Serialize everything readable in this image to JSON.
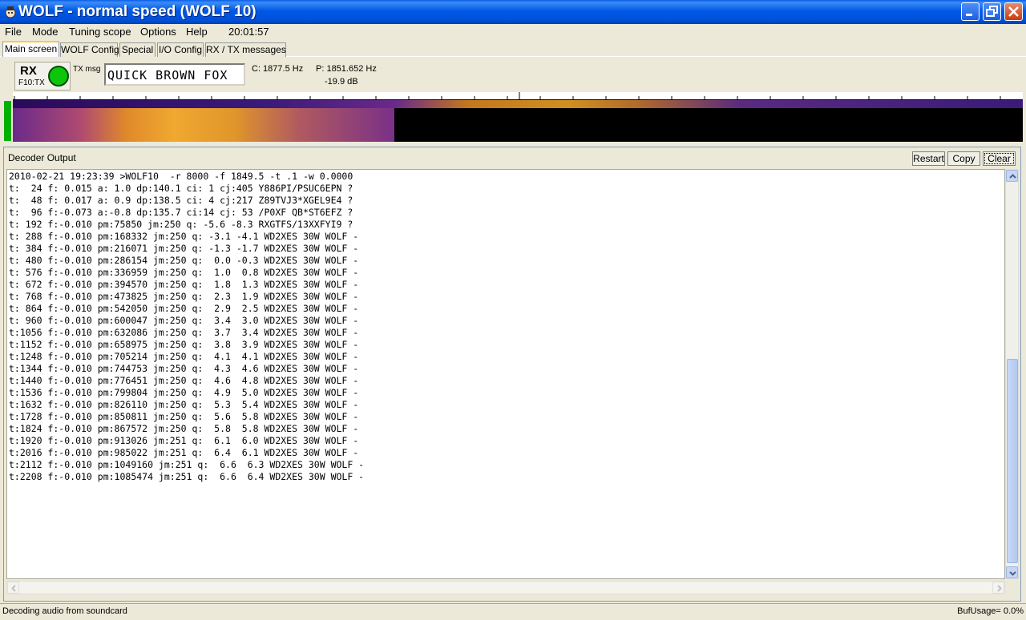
{
  "window": {
    "title": "WOLF - normal speed (WOLF 10)"
  },
  "menu": {
    "items": [
      "File",
      "Mode",
      "Tuning scope",
      "Options",
      "Help"
    ],
    "clock": "20:01:57"
  },
  "tabs": [
    {
      "label": "Main screen",
      "active": true
    },
    {
      "label": "WOLF Config"
    },
    {
      "label": "Special"
    },
    {
      "label": "I/O Config"
    },
    {
      "label": "RX / TX messages"
    }
  ],
  "rx_panel": {
    "mode": "RX",
    "hint": "F10:TX",
    "txmsg_label": "TX msg",
    "txmsg_value": "QUICK BROWN FOX",
    "c_freq": "C: 1877.5 Hz",
    "p_freq": "P: 1851.652 Hz",
    "p_db": "-19.9 dB",
    "led_color": "#0cc60c"
  },
  "decoder": {
    "title": "Decoder Output",
    "buttons": [
      "Restart",
      "Copy",
      "Clear"
    ],
    "lines": [
      "2010-02-21 19:23:39 >WOLF10  -r 8000 -f 1849.5 -t .1 -w 0.0000",
      "t:  24 f: 0.015 a: 1.0 dp:140.1 ci: 1 cj:405 Y886PI/PSUC6EPN ?",
      "t:  48 f: 0.017 a: 0.9 dp:138.5 ci: 4 cj:217 Z89TVJ3*XGEL9E4 ?",
      "t:  96 f:-0.073 a:-0.8 dp:135.7 ci:14 cj: 53 /P0XF QB*ST6EFZ ?",
      "t: 192 f:-0.010 pm:75850 jm:250 q: -5.6 -8.3 RXGTFS/13XXFYI9 ?",
      "t: 288 f:-0.010 pm:168332 jm:250 q: -3.1 -4.1 WD2XES 30W WOLF -",
      "t: 384 f:-0.010 pm:216071 jm:250 q: -1.3 -1.7 WD2XES 30W WOLF -",
      "t: 480 f:-0.010 pm:286154 jm:250 q:  0.0 -0.3 WD2XES 30W WOLF -",
      "t: 576 f:-0.010 pm:336959 jm:250 q:  1.0  0.8 WD2XES 30W WOLF -",
      "t: 672 f:-0.010 pm:394570 jm:250 q:  1.8  1.3 WD2XES 30W WOLF -",
      "t: 768 f:-0.010 pm:473825 jm:250 q:  2.3  1.9 WD2XES 30W WOLF -",
      "t: 864 f:-0.010 pm:542050 jm:250 q:  2.9  2.5 WD2XES 30W WOLF -",
      "t: 960 f:-0.010 pm:600047 jm:250 q:  3.4  3.0 WD2XES 30W WOLF -",
      "t:1056 f:-0.010 pm:632086 jm:250 q:  3.7  3.4 WD2XES 30W WOLF -",
      "t:1152 f:-0.010 pm:658975 jm:250 q:  3.8  3.9 WD2XES 30W WOLF -",
      "t:1248 f:-0.010 pm:705214 jm:250 q:  4.1  4.1 WD2XES 30W WOLF -",
      "t:1344 f:-0.010 pm:744753 jm:250 q:  4.3  4.6 WD2XES 30W WOLF -",
      "t:1440 f:-0.010 pm:776451 jm:250 q:  4.6  4.8 WD2XES 30W WOLF -",
      "t:1536 f:-0.010 pm:799804 jm:250 q:  4.9  5.0 WD2XES 30W WOLF -",
      "t:1632 f:-0.010 pm:826110 jm:250 q:  5.3  5.4 WD2XES 30W WOLF -",
      "t:1728 f:-0.010 pm:850811 jm:250 q:  5.6  5.8 WD2XES 30W WOLF -",
      "t:1824 f:-0.010 pm:867572 jm:250 q:  5.8  5.8 WD2XES 30W WOLF -",
      "t:1920 f:-0.010 pm:913026 jm:251 q:  6.1  6.0 WD2XES 30W WOLF -",
      "t:2016 f:-0.010 pm:985022 jm:251 q:  6.4  6.1 WD2XES 30W WOLF -",
      "t:2112 f:-0.010 pm:1049160 jm:251 q:  6.6  6.3 WD2XES 30W WOLF -",
      "t:2208 f:-0.010 pm:1085474 jm:251 q:  6.6  6.4 WD2XES 30W WOLF -"
    ]
  },
  "status": {
    "left": "Decoding audio from soundcard",
    "right": "BufUsage= 0.0%"
  }
}
